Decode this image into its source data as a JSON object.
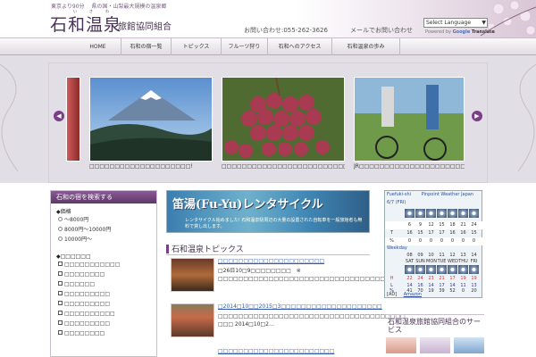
{
  "header": {
    "tagline": "東京より90分 　県の国・山梨最大規模の温泉郷",
    "logo_main": "石和温泉",
    "logo_ruby": "いさわ",
    "logo_sub": "旅館協同組合",
    "phone": "お問い合わせ:055-262-3626",
    "mail": "メールでお問い合わせ",
    "language_select": "Select Language",
    "powered_by": "Powered by",
    "google": "Google",
    "translate": "Translate"
  },
  "nav": {
    "items": [
      "HOME",
      "石和の宿一覧",
      "トピックス",
      "フルーツ狩り",
      "石和へのアクセス",
      "石和温泉の歩み"
    ]
  },
  "hero": {
    "captions": [
      "□□□□□□□□□□□□□□□□□□□□!",
      "□□□□□□□□□□□□□□□□□□□□□□□□□□",
      "JR□□□□□□□□□□□□□□□□□□□□□"
    ],
    "prev_label": "◀",
    "next_label": "▶"
  },
  "search": {
    "title": "石和の宿を検索する",
    "price_heading": "◆価格",
    "price_options": [
      "～8000円",
      "8000円～10000円",
      "10000円～"
    ],
    "feature_heading": "◆□□□□□□",
    "feature_options": [
      "□□□□□□□□□□□",
      "□□□□□□□□",
      "□□□□□□",
      "□□□□□□□□□",
      "□□□□□□□□□",
      "□□□□□□□□□□",
      "□□□□□□□□□",
      "□□□□□□□□"
    ]
  },
  "banner": {
    "title": "笛湯(Fu-Yu)レンタサイクル",
    "text": "レンタサイクル始めました!\n石和温泉駅周辺の大量の設置された自転車を一般旅館者も無料で貸し出します。"
  },
  "topics": {
    "title": "石和温泉トピックス",
    "items": [
      {
        "link": "□□□□□□□□□□□□□□□□□□□□□",
        "text": "□26日10□9□□□□□□□□　※ □□□□□□□□□□□□□□□□□□□□□□□□□□□□□□□□□□□□□□□□□□□□□□□…"
      },
      {
        "link": "□2014□10□□2015□3□□□□□□□□□□□□□□□□□□□□",
        "text": "□□□□□□□□□□□□□□□□□□□□□□□□□□□□□□□□□□□□□　□□□ 2014□10□2…"
      },
      {
        "link": "□□□□□□□□□□□□□□□□□□□□□□□",
        "text": ""
      }
    ]
  },
  "weather": {
    "location": "Fuefuki-shi",
    "title": "Pinpoint Weather Japan",
    "day1": "6/7 (FRI)",
    "hours": [
      "6",
      "9",
      "12",
      "15",
      "18",
      "21",
      "24"
    ],
    "temps1": [
      "16",
      "15",
      "17",
      "17",
      "16",
      "16",
      "15"
    ],
    "pct1": [
      "0",
      "0",
      "0",
      "0",
      "0",
      "0",
      "0"
    ],
    "weekday_label": "Weekday",
    "dates": [
      "08",
      "09",
      "10",
      "11",
      "12",
      "13",
      "14"
    ],
    "days": [
      "SAT",
      "SUN",
      "MON",
      "TUE",
      "WED",
      "THU",
      "FRI"
    ],
    "highs": [
      "22",
      "24",
      "23",
      "21",
      "17",
      "19",
      "19"
    ],
    "lows": [
      "14",
      "16",
      "14",
      "17",
      "14",
      "11",
      "13"
    ],
    "pct2": [
      "41",
      "70",
      "19",
      "39",
      "52",
      "0",
      "20"
    ],
    "ad": "[AD]",
    "amazon": "Amazon",
    "row_labels": [
      "T",
      "%",
      "W",
      "H",
      "L",
      "%"
    ]
  },
  "service": {
    "title": "石和温泉旅館協同組合のサービス"
  },
  "colors": {
    "brand": "#4a3357",
    "accent": "#7a3f86",
    "link": "#3358a8"
  }
}
